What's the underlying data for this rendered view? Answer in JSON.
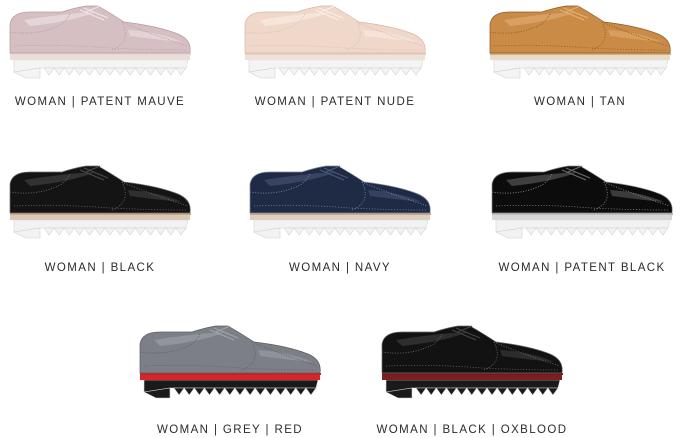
{
  "products": [
    {
      "label": "WOMAN | PATENT MAUVE",
      "upper": "#d5bfc3",
      "shine": "#f1e7e9",
      "detail": "#b59aa0",
      "midsole": "#e9dfd8",
      "sole": "#f4f4f4",
      "welt": "#e8d7cf"
    },
    {
      "label": "WOMAN | PATENT NUDE",
      "upper": "#efd7c9",
      "shine": "#fbf0ea",
      "detail": "#d7b8a8",
      "midsole": "#efe3d9",
      "sole": "#f4f4f4",
      "welt": "#e6d0c2"
    },
    {
      "label": "WOMAN | TAN",
      "upper": "#c98b45",
      "shine": "#e4b27a",
      "detail": "#8e5a25",
      "midsole": "#e8dccd",
      "sole": "#f4f4f4",
      "welt": "#d4b07e"
    },
    {
      "label": "WOMAN | BLACK",
      "upper": "#141414",
      "shine": "#4a4a4a",
      "detail": "#6d6d6d",
      "midsole": "#d9c9b6",
      "sole": "#f2f2f2",
      "welt": "#c9a98a"
    },
    {
      "label": "WOMAN | NAVY",
      "upper": "#1f2a44",
      "shine": "#4c5a7a",
      "detail": "#7d88a3",
      "midsole": "#ddd0bf",
      "sole": "#f2f2f2",
      "welt": "#c9a98a"
    },
    {
      "label": "WOMAN | PATENT BLACK",
      "upper": "#0c0c0c",
      "shine": "#6a6a6a",
      "detail": "#8a8a8a",
      "midsole": "#d6d6d6",
      "sole": "#f2f2f2",
      "welt": "#bdbdbd"
    },
    {
      "label": "WOMAN | GREY | RED",
      "upper": "#7d7f86",
      "shine": "#a3a5ab",
      "detail": "#5b5d63",
      "midsole": "#d8252b",
      "sole": "#1a1a1a",
      "welt": "#c62026"
    },
    {
      "label": "WOMAN | BLACK | OXBLOOD",
      "upper": "#121212",
      "shine": "#454545",
      "detail": "#6b6b6b",
      "midsole": "#7d1f22",
      "sole": "#1a1a1a",
      "welt": "#6a1a1d"
    }
  ]
}
